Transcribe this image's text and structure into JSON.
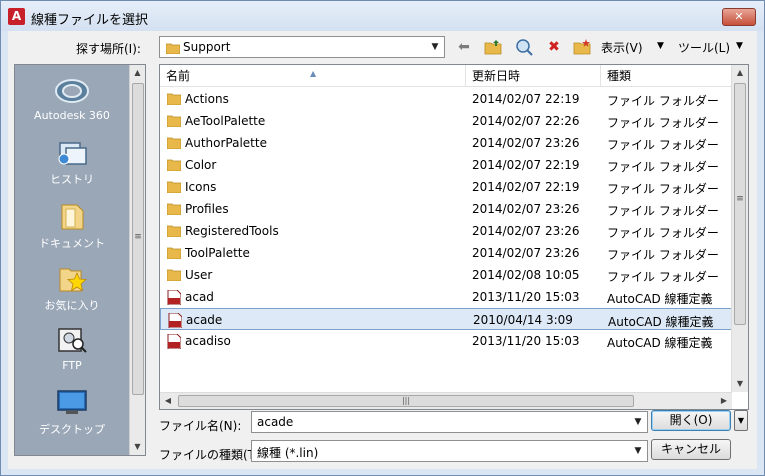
{
  "window": {
    "title": "線種ファイルを選択",
    "close_label": "✕"
  },
  "toolbar": {
    "lookin_label": "探す場所(I):",
    "lookin_value": "Support",
    "view_label": "表示(V)",
    "tools_label": "ツール(L)"
  },
  "places": [
    {
      "label": "Autodesk 360",
      "icon": "autodesk-360-icon"
    },
    {
      "label": "ヒストリ",
      "icon": "history-icon"
    },
    {
      "label": "ドキュメント",
      "icon": "documents-icon"
    },
    {
      "label": "お気に入り",
      "icon": "favorites-icon"
    },
    {
      "label": "FTP",
      "icon": "ftp-icon"
    },
    {
      "label": "デスクトップ",
      "icon": "desktop-icon"
    }
  ],
  "columns": {
    "name": "名前",
    "date": "更新日時",
    "type": "種類"
  },
  "files": [
    {
      "name": "Actions",
      "date": "2014/02/07 22:19",
      "type": "ファイル フォルダー",
      "kind": "folder"
    },
    {
      "name": "AeToolPalette",
      "date": "2014/02/07 22:26",
      "type": "ファイル フォルダー",
      "kind": "folder"
    },
    {
      "name": "AuthorPalette",
      "date": "2014/02/07 23:26",
      "type": "ファイル フォルダー",
      "kind": "folder"
    },
    {
      "name": "Color",
      "date": "2014/02/07 22:19",
      "type": "ファイル フォルダー",
      "kind": "folder"
    },
    {
      "name": "Icons",
      "date": "2014/02/07 22:19",
      "type": "ファイル フォルダー",
      "kind": "folder"
    },
    {
      "name": "Profiles",
      "date": "2014/02/07 23:26",
      "type": "ファイル フォルダー",
      "kind": "folder"
    },
    {
      "name": "RegisteredTools",
      "date": "2014/02/07 23:26",
      "type": "ファイル フォルダー",
      "kind": "folder"
    },
    {
      "name": "ToolPalette",
      "date": "2014/02/07 23:26",
      "type": "ファイル フォルダー",
      "kind": "folder"
    },
    {
      "name": "User",
      "date": "2014/02/08 10:05",
      "type": "ファイル フォルダー",
      "kind": "folder"
    },
    {
      "name": "acad",
      "date": "2013/11/20 15:03",
      "type": "AutoCAD 線種定義",
      "kind": "lin"
    },
    {
      "name": "acade",
      "date": "2010/04/14 3:09",
      "type": "AutoCAD 線種定義",
      "kind": "lin",
      "selected": true
    },
    {
      "name": "acadiso",
      "date": "2013/11/20 15:03",
      "type": "AutoCAD 線種定義",
      "kind": "lin"
    }
  ],
  "filename": {
    "label": "ファイル名(N):",
    "value": "acade"
  },
  "filetype": {
    "label": "ファイルの種類(T):",
    "value": "線種 (*.lin)"
  },
  "buttons": {
    "open": "開く(O)",
    "cancel": "キャンセル"
  },
  "colors": {
    "selected_row": "#dde9f7",
    "places_bg": "#9aa7b7",
    "folder": "#e8b94a",
    "lin_icon": "#b32222"
  }
}
